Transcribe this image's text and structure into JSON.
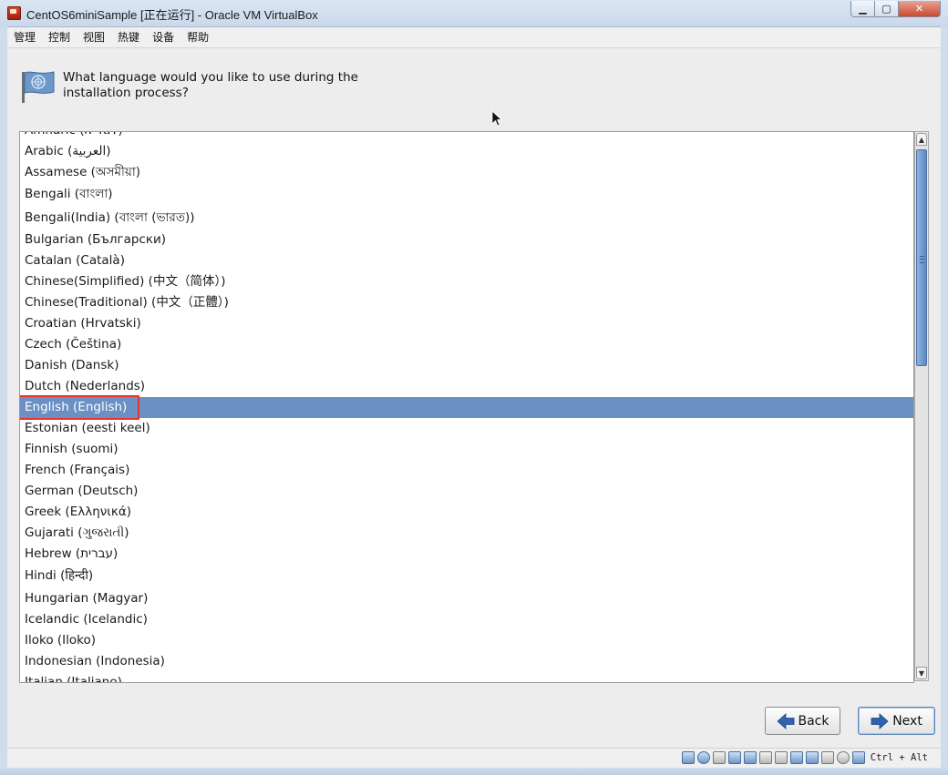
{
  "window": {
    "title": "CentOS6miniSample [正在运行] - Oracle VM VirtualBox",
    "minimize_label": "▁",
    "maximize_label": "▢",
    "close_label": "✕"
  },
  "menu": [
    "管理",
    "控制",
    "视图",
    "热键",
    "设备",
    "帮助"
  ],
  "installer": {
    "prompt_line1": "What language would you like to use during the",
    "prompt_line2": "installation process?",
    "languages": [
      "Amharic (አማርኛ)",
      "Arabic (العربية)",
      "Assamese (অসমীয়া)",
      "Bengali (বাংলা)",
      "Bengali(India) (বাংলা (ভারত))",
      "Bulgarian (Български)",
      "Catalan (Català)",
      "Chinese(Simplified) (中文（简体）)",
      "Chinese(Traditional) (中文（正體）)",
      "Croatian (Hrvatski)",
      "Czech (Čeština)",
      "Danish (Dansk)",
      "Dutch (Nederlands)",
      "English (English)",
      "Estonian (eesti keel)",
      "Finnish (suomi)",
      "French (Français)",
      "German (Deutsch)",
      "Greek (Ελληνικά)",
      "Gujarati (ગુજરાતી)",
      "Hebrew (עברית)",
      "Hindi (हिन्दी)",
      "Hungarian (Magyar)",
      "Icelandic (Icelandic)",
      "Iloko (Iloko)",
      "Indonesian (Indonesia)",
      "Italian (Italiano)"
    ],
    "selected_language": "English (English)",
    "back_label": "Back",
    "next_label": "Next"
  },
  "status": {
    "host_key": "Ctrl + Alt",
    "icons": [
      "hard-disk-icon",
      "optical-drive-icon",
      "audio-icon",
      "network-icon",
      "usb-icon",
      "shared-folders-icon",
      "display-icon",
      "video-capture-icon",
      "virtualization-icon",
      "mouse-integration-icon",
      "cpu-icon",
      "keyboard-capture-icon"
    ]
  },
  "colors": {
    "selection": "#6a90c4",
    "highlight_outline": "#e8342b",
    "arrow_blue": "#2f62b0"
  }
}
